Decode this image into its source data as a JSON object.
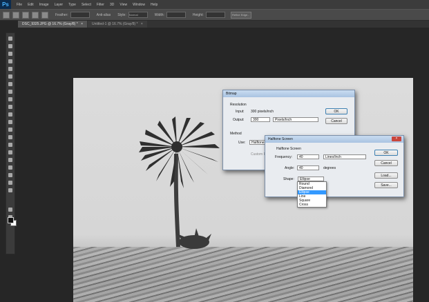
{
  "app": {
    "logo_text": "Ps"
  },
  "menu": {
    "items": [
      "File",
      "Edit",
      "Image",
      "Layer",
      "Type",
      "Select",
      "Filter",
      "3D",
      "View",
      "Window",
      "Help"
    ]
  },
  "options_bar": {
    "feather_label": "Feather:",
    "anti_alias_label": "Anti-alias",
    "style_label": "Style:",
    "style_value": "Normal",
    "width_label": "Width:",
    "height_label": "Height:",
    "refine_edge_label": "Refine Edge..."
  },
  "tabs": [
    {
      "label": "DSC_9325.JPG @ 16.7% (Gray/8) *",
      "close": "×"
    },
    {
      "label": "Untitled-1 @ 16.7% (Gray/8) *",
      "close": "×"
    }
  ],
  "bitmap_dialog": {
    "title": "Bitmap",
    "resolution_heading": "Resolution",
    "input_label": "Input:",
    "input_value": "300 pixels/inch",
    "output_label": "Output:",
    "output_value": "300",
    "output_unit": "Pixels/Inch",
    "method_heading": "Method",
    "use_label": "Use:",
    "use_value": "Halftone Screen...",
    "custom_label": "Custom Pattern",
    "ok_label": "OK",
    "cancel_label": "Cancel"
  },
  "halftone_dialog": {
    "title": "Halftone Screen",
    "heading": "Halftone Screen",
    "frequency_label": "Frequency:",
    "frequency_value": "40",
    "frequency_unit": "Lines/Inch",
    "angle_label": "Angle:",
    "angle_value": "40",
    "angle_unit": "degrees",
    "shape_label": "Shape:",
    "shape_value": "Ellipse",
    "ok_label": "OK",
    "cancel_label": "Cancel",
    "load_label": "Load...",
    "save_label": "Save...",
    "close_label": "×"
  },
  "shape_options": [
    "Round",
    "Diamond",
    "Ellipse",
    "Line",
    "Square",
    "Cross"
  ],
  "shape_selected": "Ellipse"
}
